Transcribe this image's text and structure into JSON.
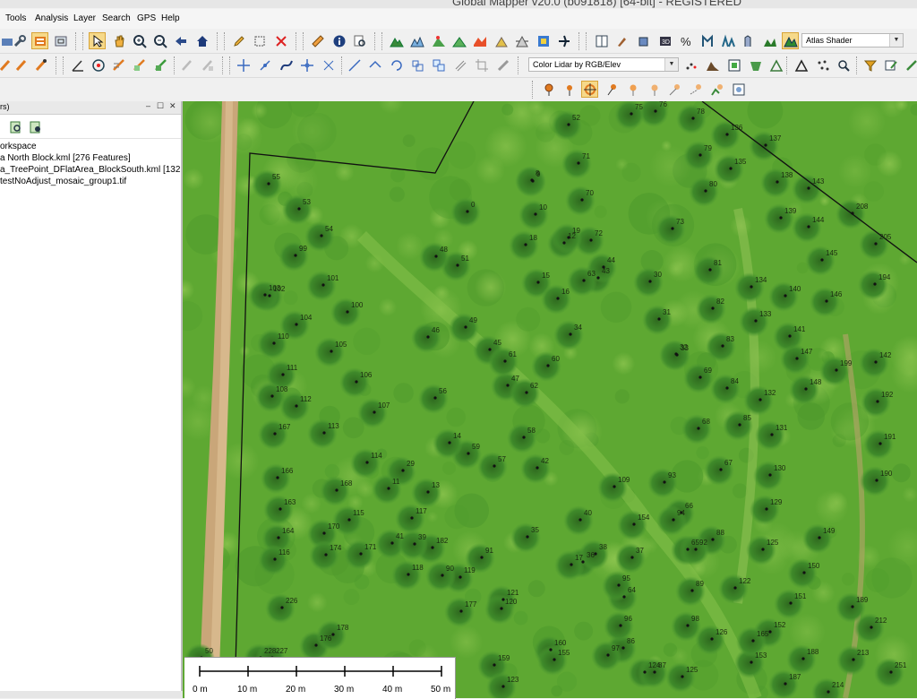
{
  "window": {
    "title": "Global Mapper v20.0 (b091818) [64-bit] - REGISTERED"
  },
  "menu": [
    "Tools",
    "Analysis",
    "Layer",
    "Search",
    "GPS",
    "Help"
  ],
  "toolbar": {
    "shader_select": "Atlas Shader",
    "lidar_color_select": "Color Lidar by RGB/Elev"
  },
  "control_center": {
    "header": "rs)",
    "items": [
      "orkspace",
      "a North Block.kml [276 Features]",
      "a_TreePoint_DFlatArea_BlockSouth.kml [132",
      "testNoAdjust_mosaic_group1.tif"
    ]
  },
  "scale_bar": {
    "labels": [
      "0 m",
      "10 m",
      "20 m",
      "30 m",
      "40 m",
      "50 m"
    ]
  },
  "tree_labels": [
    {
      "t": "76"
    },
    {
      "t": "78"
    },
    {
      "t": "136"
    },
    {
      "t": "137"
    },
    {
      "t": "135"
    },
    {
      "t": "138"
    },
    {
      "t": "143"
    },
    {
      "t": "139"
    },
    {
      "t": "144"
    },
    {
      "t": "208"
    },
    {
      "t": "205"
    },
    {
      "t": "145"
    },
    {
      "t": "146"
    },
    {
      "t": "194"
    },
    {
      "t": "140"
    },
    {
      "t": "134"
    },
    {
      "t": "133"
    },
    {
      "t": "141"
    },
    {
      "t": "147"
    },
    {
      "t": "142"
    },
    {
      "t": "148"
    },
    {
      "t": "199"
    },
    {
      "t": "192"
    },
    {
      "t": "191"
    },
    {
      "t": "190"
    },
    {
      "t": "132"
    },
    {
      "t": "131"
    },
    {
      "t": "130"
    },
    {
      "t": "129"
    },
    {
      "t": "149"
    },
    {
      "t": "125"
    },
    {
      "t": "150"
    },
    {
      "t": "122"
    },
    {
      "t": "151"
    },
    {
      "t": "189"
    },
    {
      "t": "212"
    },
    {
      "t": "152"
    },
    {
      "t": "188"
    },
    {
      "t": "213"
    },
    {
      "t": "153"
    },
    {
      "t": "187"
    },
    {
      "t": "214"
    },
    {
      "t": "251"
    },
    {
      "t": "9"
    },
    {
      "t": "52"
    },
    {
      "t": "71"
    },
    {
      "t": "79"
    },
    {
      "t": "80"
    },
    {
      "t": "70"
    },
    {
      "t": "73"
    },
    {
      "t": "72"
    },
    {
      "t": "75"
    },
    {
      "t": "8"
    },
    {
      "t": "10"
    },
    {
      "t": "12"
    },
    {
      "t": "81"
    },
    {
      "t": "30"
    },
    {
      "t": "31"
    },
    {
      "t": "32"
    },
    {
      "t": "82"
    },
    {
      "t": "83"
    },
    {
      "t": "33"
    },
    {
      "t": "69"
    },
    {
      "t": "84"
    },
    {
      "t": "85"
    },
    {
      "t": "68"
    },
    {
      "t": "67"
    },
    {
      "t": "88"
    },
    {
      "t": "89"
    },
    {
      "t": "65"
    },
    {
      "t": "66"
    },
    {
      "t": "64"
    },
    {
      "t": "126"
    },
    {
      "t": "125"
    },
    {
      "t": "124"
    },
    {
      "t": "0"
    },
    {
      "t": "55"
    },
    {
      "t": "53"
    },
    {
      "t": "54"
    },
    {
      "t": "99"
    },
    {
      "t": "102"
    },
    {
      "t": "101"
    },
    {
      "t": "103"
    },
    {
      "t": "100"
    },
    {
      "t": "104"
    },
    {
      "t": "105"
    },
    {
      "t": "110"
    },
    {
      "t": "111"
    },
    {
      "t": "108"
    },
    {
      "t": "106"
    },
    {
      "t": "112"
    },
    {
      "t": "107"
    },
    {
      "t": "113"
    },
    {
      "t": "167"
    },
    {
      "t": "114"
    },
    {
      "t": "166"
    },
    {
      "t": "168"
    },
    {
      "t": "163"
    },
    {
      "t": "115"
    },
    {
      "t": "170"
    },
    {
      "t": "164"
    },
    {
      "t": "171"
    },
    {
      "t": "174"
    },
    {
      "t": "116"
    },
    {
      "t": "117"
    },
    {
      "t": "182"
    },
    {
      "t": "118"
    },
    {
      "t": "119"
    },
    {
      "t": "177"
    },
    {
      "t": "176"
    },
    {
      "t": "178"
    },
    {
      "t": "226"
    },
    {
      "t": "228"
    },
    {
      "t": "227"
    },
    {
      "t": "50"
    },
    {
      "t": "51"
    },
    {
      "t": "48"
    },
    {
      "t": "49"
    },
    {
      "t": "46"
    },
    {
      "t": "47"
    },
    {
      "t": "45"
    },
    {
      "t": "60"
    },
    {
      "t": "61"
    },
    {
      "t": "62"
    },
    {
      "t": "58"
    },
    {
      "t": "59"
    },
    {
      "t": "57"
    },
    {
      "t": "56"
    },
    {
      "t": "14"
    },
    {
      "t": "13"
    },
    {
      "t": "11"
    },
    {
      "t": "18"
    },
    {
      "t": "19"
    },
    {
      "t": "15"
    },
    {
      "t": "43"
    },
    {
      "t": "44"
    },
    {
      "t": "42"
    },
    {
      "t": "41"
    },
    {
      "t": "39"
    },
    {
      "t": "40"
    },
    {
      "t": "36"
    },
    {
      "t": "37"
    },
    {
      "t": "38"
    },
    {
      "t": "93"
    },
    {
      "t": "94"
    },
    {
      "t": "92"
    },
    {
      "t": "91"
    },
    {
      "t": "90"
    },
    {
      "t": "121"
    },
    {
      "t": "120"
    },
    {
      "t": "160"
    },
    {
      "t": "155"
    },
    {
      "t": "159"
    },
    {
      "t": "123"
    },
    {
      "t": "86"
    },
    {
      "t": "87"
    },
    {
      "t": "98"
    },
    {
      "t": "97"
    },
    {
      "t": "96"
    },
    {
      "t": "95"
    },
    {
      "t": "154"
    },
    {
      "t": "109"
    },
    {
      "t": "165"
    },
    {
      "t": "29"
    },
    {
      "t": "17"
    },
    {
      "t": "16"
    },
    {
      "t": "63"
    },
    {
      "t": "34"
    },
    {
      "t": "35"
    }
  ],
  "colors": {
    "map_green": "#5ea832",
    "boundary": "#111111"
  }
}
